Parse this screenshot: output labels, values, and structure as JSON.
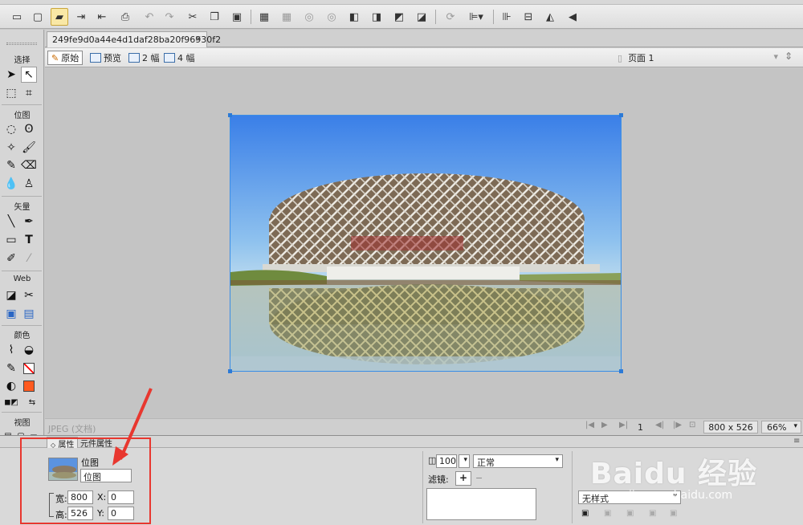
{
  "window": {
    "menu_strip": ""
  },
  "toolbar": {
    "buttons": [
      "new-icon",
      "save-icon",
      "open-icon",
      "import-icon",
      "export-icon",
      "print-icon",
      "undo-icon",
      "redo-icon",
      "cut-icon",
      "copy-icon",
      "paste-icon",
      "group-icon",
      "ungroup-icon",
      "join-icon",
      "split-icon",
      "bring-front-icon",
      "send-back-icon",
      "combine-icon",
      "distribute-icon",
      "rotate-icon",
      "align-icon",
      "flip-horizontal-icon",
      "flip-vertical-icon",
      "more-icon"
    ],
    "search_placeholder": ""
  },
  "document": {
    "tab_title": "249fe9d0a44e4d1daf28ba20f96930f2",
    "tab_close": "×"
  },
  "viewbar": {
    "original": "原始",
    "preview": "预览",
    "two_up": "2 幅",
    "four_up": "4 幅",
    "page": "页面 1"
  },
  "tools": {
    "sections": [
      "选择",
      "位图",
      "矢量",
      "Web",
      "颜色",
      "视图"
    ],
    "accent_stroke": "#ff0000",
    "accent_fill": "#ff5a1f"
  },
  "status": {
    "doc_type": "JPEG (文档)",
    "page_number": "1",
    "image_size": "800 x 526",
    "zoom": "66%"
  },
  "properties": {
    "tabs": [
      "属性",
      "元件属性"
    ],
    "object_type": "位图",
    "object_name": "位图",
    "width_label": "宽:",
    "width": "800",
    "height_label": "高:",
    "height": "526",
    "x_label": "X:",
    "x": "0",
    "y_label": "Y:",
    "y": "0",
    "opacity": "100",
    "blend_mode": "正常",
    "filter_label": "滤镜:",
    "style": "无样式"
  },
  "watermark": {
    "brand": "Baidu 经验",
    "url": "jingyan.baidu.com"
  },
  "colors": {
    "selection": "#3a8ee6",
    "highlight_box": "#e8372f"
  }
}
